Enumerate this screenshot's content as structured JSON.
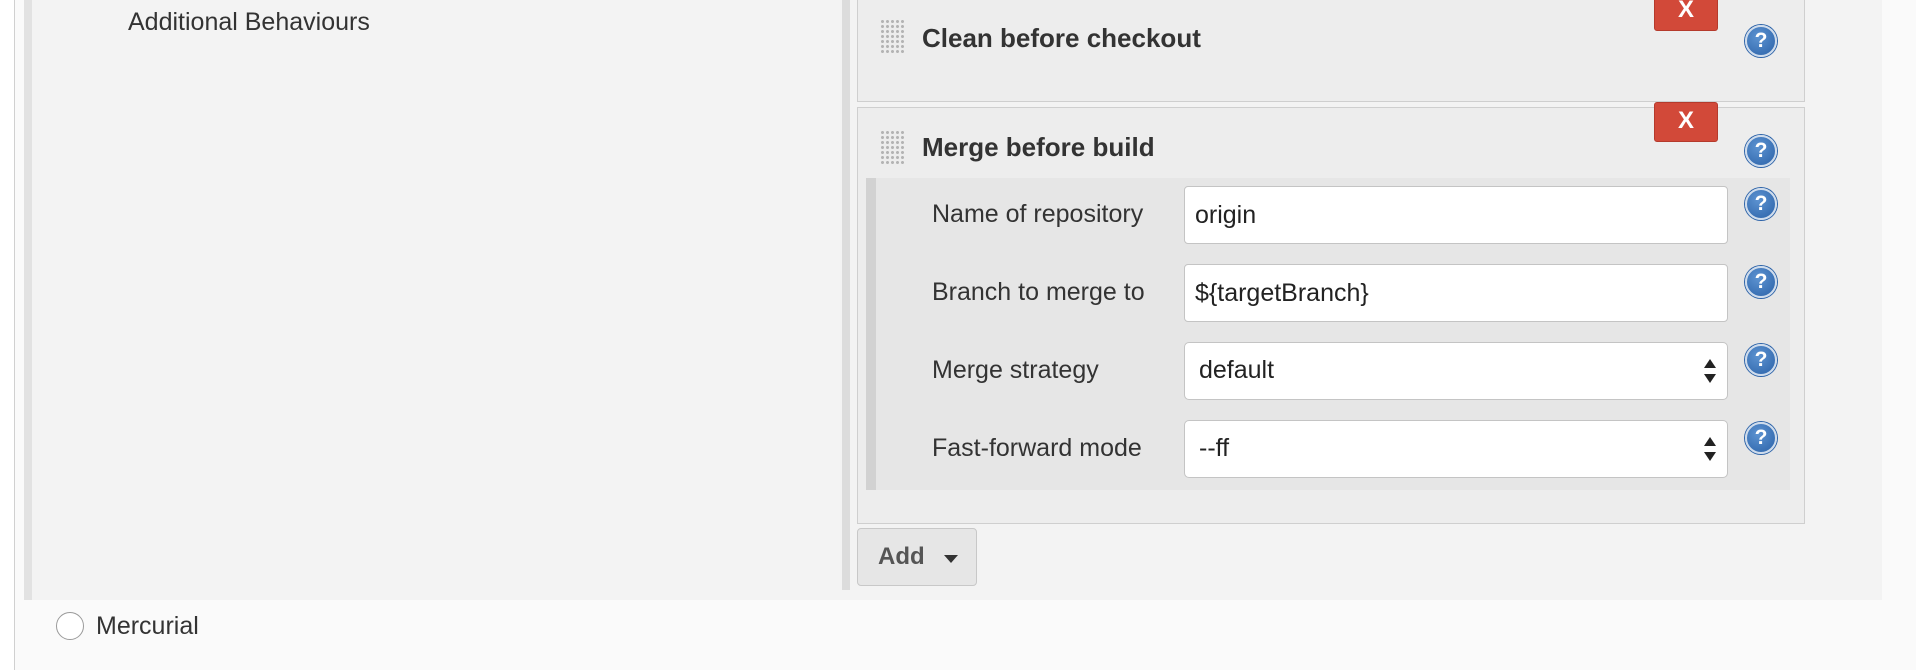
{
  "git_scm": {
    "section_label": "Additional Behaviours",
    "behaviours": [
      {
        "title": "Clean before checkout",
        "delete_label": "X",
        "help_glyph": "?"
      },
      {
        "title": "Merge before build",
        "delete_label": "X",
        "help_glyph": "?",
        "fields": {
          "repository": {
            "label": "Name of repository",
            "value": "origin"
          },
          "branch": {
            "label": "Branch to merge to",
            "value": "${targetBranch}"
          },
          "strategy": {
            "label": "Merge strategy",
            "selected": "default"
          },
          "fast_forward": {
            "label": "Fast-forward mode",
            "selected": "--ff"
          }
        }
      }
    ],
    "add_button": "Add"
  },
  "scm_options": {
    "mercurial": "Mercurial"
  },
  "colors": {
    "delete_button": "#d24939",
    "help_icon": "#2b62a8",
    "panel_background": "#ededed"
  },
  "icons": {
    "help": "help-icon",
    "drag": "drag-handle-icon",
    "dropdown": "chevron-down-icon",
    "select": "select-arrows-icon"
  }
}
